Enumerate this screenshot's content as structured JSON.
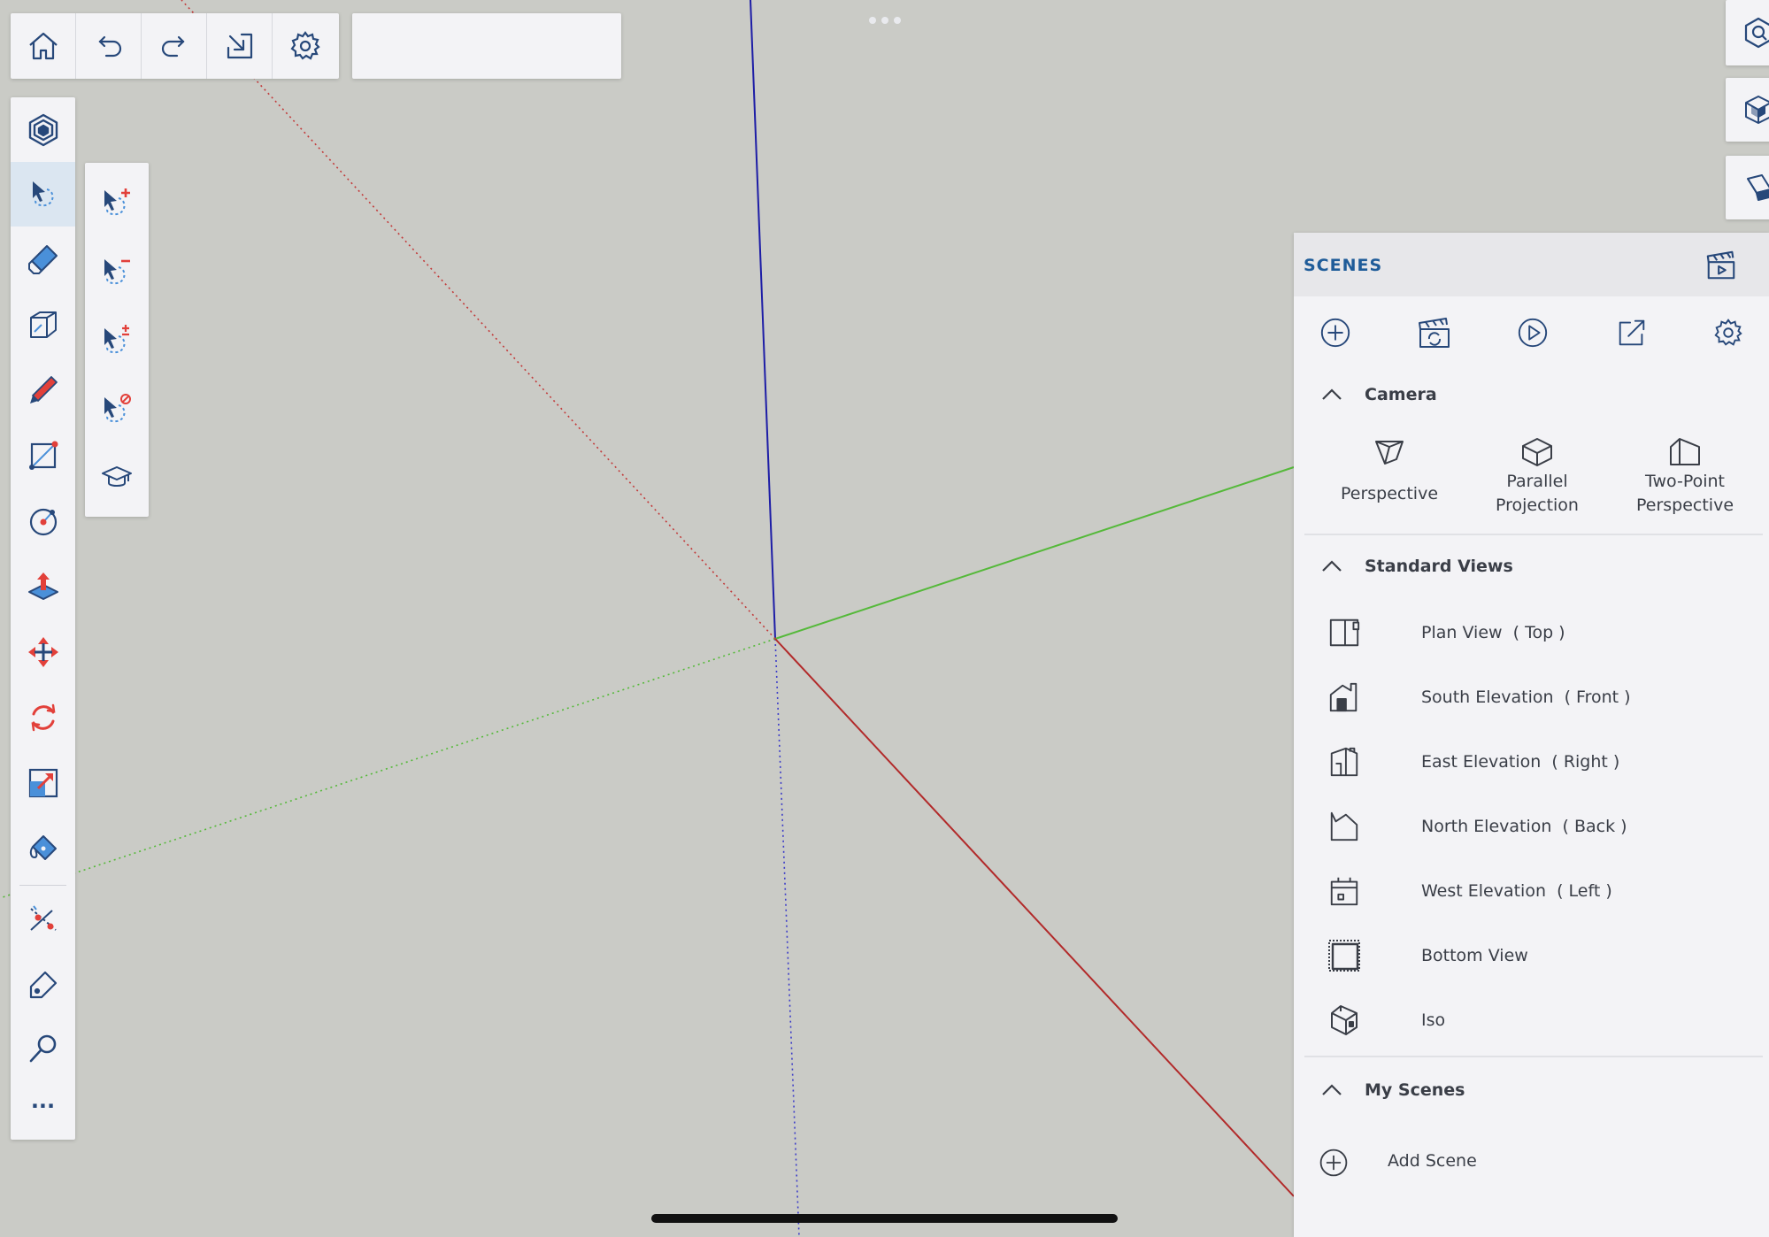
{
  "app": {
    "accent_color": "#1f5c99",
    "axis_colors": {
      "x_red": "#b22a2a",
      "y_green": "#55b93a",
      "z_blue": "#1d1da6"
    }
  },
  "top_toolbar": {
    "buttons": [
      {
        "name": "home",
        "icon": "home-icon"
      },
      {
        "name": "undo",
        "icon": "undo-icon"
      },
      {
        "name": "redo",
        "icon": "redo-icon"
      },
      {
        "name": "import",
        "icon": "import-icon"
      },
      {
        "name": "settings",
        "icon": "gear-icon"
      }
    ],
    "search_value": ""
  },
  "left_toolbar": {
    "tools": [
      "object-info-icon",
      "select-icon",
      "eraser-icon",
      "tape-measure-icon",
      "pencil-icon",
      "rectangle-icon",
      "circle-icon",
      "push-pull-icon",
      "move-icon",
      "rotate-icon",
      "scale-icon",
      "paint-bucket-icon",
      "section-plane-icon",
      "tag-icon",
      "search-icon",
      "more-icon"
    ],
    "active_tool": "select-icon",
    "more_label": "···"
  },
  "select_flyout": {
    "tools": [
      "select-add-icon",
      "select-subtract-icon",
      "select-toggle-icon",
      "select-none-icon",
      "instructor-icon"
    ]
  },
  "right_buttons": [
    "view-navigation-icon",
    "component-icon",
    "materials-icon"
  ],
  "scenes": {
    "title": "SCENES",
    "actions": [
      "add-icon",
      "update-scene-icon",
      "play-icon",
      "export-icon",
      "gear-icon"
    ],
    "camera": {
      "heading": "Camera",
      "options": [
        {
          "label_lines": [
            "Perspective"
          ],
          "icon": "perspective-icon"
        },
        {
          "label_lines": [
            "Parallel",
            "Projection"
          ],
          "icon": "parallel-projection-icon"
        },
        {
          "label_lines": [
            "Two-Point",
            "Perspective"
          ],
          "icon": "two-point-perspective-icon"
        }
      ]
    },
    "standard_views": {
      "heading": "Standard Views",
      "items": [
        {
          "label": "Plan View  ( Top )",
          "icon": "plan-view-icon"
        },
        {
          "label": "South Elevation  ( Front )",
          "icon": "south-elevation-icon"
        },
        {
          "label": "East Elevation  ( Right )",
          "icon": "east-elevation-icon"
        },
        {
          "label": "North Elevation  ( Back )",
          "icon": "north-elevation-icon"
        },
        {
          "label": "West Elevation  ( Left )",
          "icon": "west-elevation-icon"
        },
        {
          "label": "Bottom View",
          "icon": "bottom-view-icon"
        },
        {
          "label": "Iso",
          "icon": "iso-view-icon"
        }
      ]
    },
    "my_scenes": {
      "heading": "My Scenes",
      "add_label": "Add Scene"
    }
  }
}
